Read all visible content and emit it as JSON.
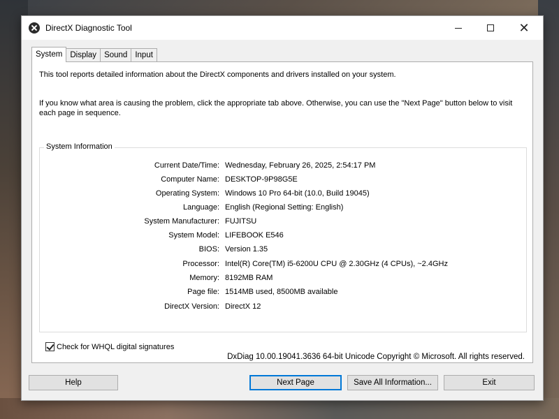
{
  "window": {
    "title": "DirectX Diagnostic Tool",
    "close_glyph": "✕"
  },
  "tabs": [
    {
      "label": "System",
      "active": true
    },
    {
      "label": "Display",
      "active": false
    },
    {
      "label": "Sound",
      "active": false
    },
    {
      "label": "Input",
      "active": false
    }
  ],
  "intro": {
    "line1": "This tool reports detailed information about the DirectX components and drivers installed on your system.",
    "line2": "If you know what area is causing the problem, click the appropriate tab above.  Otherwise, you can use the \"Next Page\" button below to visit each page in sequence."
  },
  "system_info": {
    "group_label": "System Information",
    "rows": [
      {
        "label": "Current Date/Time:",
        "value": "Wednesday, February 26, 2025, 2:54:17 PM"
      },
      {
        "label": "Computer Name:",
        "value": "DESKTOP-9P98G5E"
      },
      {
        "label": "Operating System:",
        "value": "Windows 10 Pro 64-bit (10.0, Build 19045)"
      },
      {
        "label": "Language:",
        "value": "English (Regional Setting: English)"
      },
      {
        "label": "System Manufacturer:",
        "value": "FUJITSU"
      },
      {
        "label": "System Model:",
        "value": "LIFEBOOK E546"
      },
      {
        "label": "BIOS:",
        "value": "Version 1.35"
      },
      {
        "label": "Processor:",
        "value": "Intel(R) Core(TM) i5-6200U CPU @ 2.30GHz (4 CPUs), ~2.4GHz"
      },
      {
        "label": "Memory:",
        "value": "8192MB RAM"
      },
      {
        "label": "Page file:",
        "value": "1514MB used, 8500MB available"
      },
      {
        "label": "DirectX Version:",
        "value": "DirectX 12"
      }
    ]
  },
  "checkbox": {
    "label": "Check for WHQL digital signatures",
    "checked": true
  },
  "footer": {
    "text": "DxDiag 10.00.19041.3636 64-bit Unicode  Copyright © Microsoft. All rights reserved."
  },
  "buttons": {
    "help": "Help",
    "next_page": "Next Page",
    "save_all": "Save All Information...",
    "exit": "Exit"
  },
  "colors": {
    "window_bg": "#f0f0f0",
    "panel_bg": "#ffffff",
    "button_bg": "#e1e1e1",
    "default_button_border": "#0078d7"
  },
  "icons": {
    "app": "directx-icon",
    "minimize": "minimize-icon",
    "maximize": "maximize-icon",
    "close": "close-icon",
    "checkmark": "checkmark-icon"
  }
}
